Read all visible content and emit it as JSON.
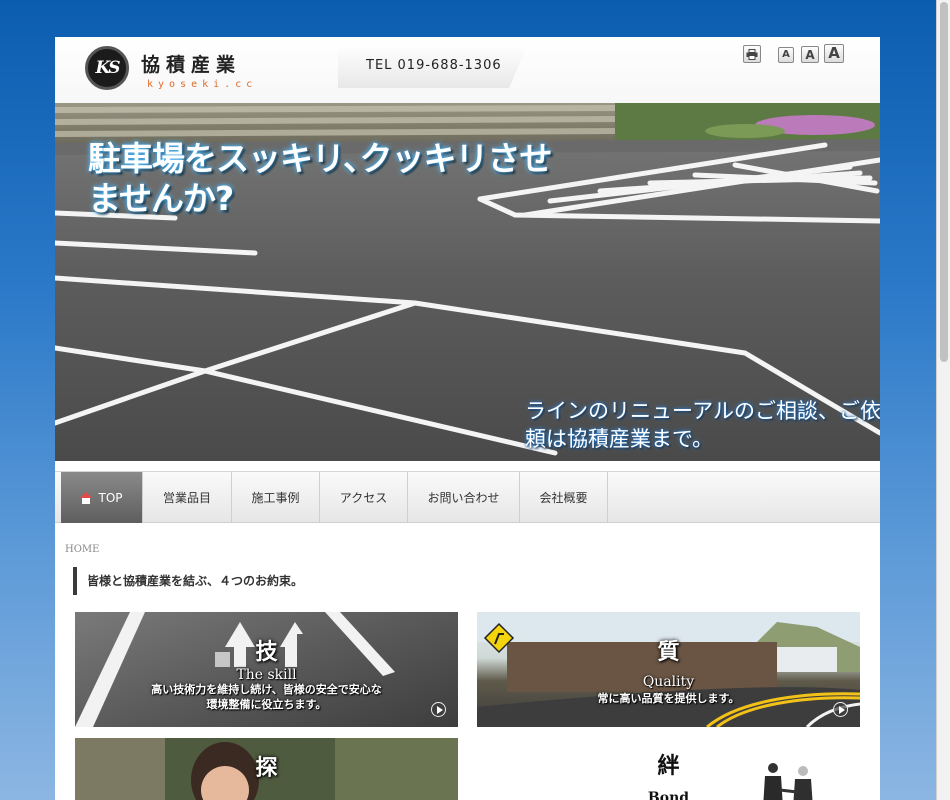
{
  "header": {
    "logo_mark": "KS",
    "company_name": "協積産業",
    "company_sub": "kyoseki.cc",
    "tel": "TEL 019-688-1306",
    "font_small": "A",
    "font_medium": "A",
    "font_large": "A"
  },
  "hero": {
    "title": "駐車場をスッキリ､クッキリさせませんか?",
    "subtitle": "ラインのリニューアルのご相談、ご依頼は協積産業まで。"
  },
  "nav": {
    "items": [
      {
        "label": "TOP",
        "active": true
      },
      {
        "label": "営業品目",
        "active": false
      },
      {
        "label": "施工事例",
        "active": false
      },
      {
        "label": "アクセス",
        "active": false
      },
      {
        "label": "お問い合わせ",
        "active": false
      },
      {
        "label": "会社概要",
        "active": false
      }
    ]
  },
  "breadcrumb": "HOME",
  "section_heading": "皆様と協積産業を結ぶ、４つのお約束。",
  "cards": {
    "skill": {
      "title": "技",
      "en": "The skill",
      "desc_line1": "高い技術力を維持し続け、皆様の安全で安心な",
      "desc_line2": "環境整備に役立ちます。"
    },
    "quality": {
      "title": "質",
      "en": "Quality",
      "desc_line1": "常に高い品質を提供します。"
    },
    "search": {
      "title": "探"
    },
    "bond": {
      "title": "絆",
      "en": "Bond"
    }
  },
  "colors": {
    "background_top": "#0b5db0",
    "background_bottom": "#8cb6e2",
    "accent_orange": "#e06a2a",
    "nav_active": "#6e6e6e"
  }
}
